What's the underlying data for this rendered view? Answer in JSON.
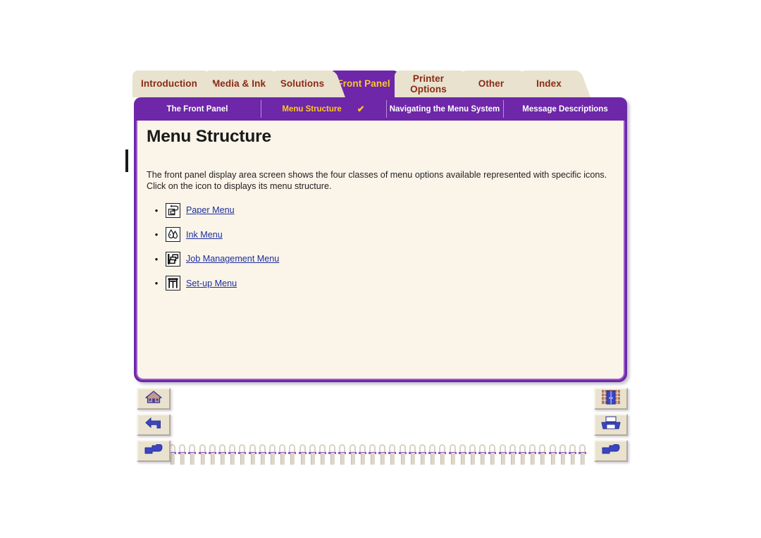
{
  "colors": {
    "purple": "#6d27a8",
    "tab_beige": "#e8e2cf",
    "tab_text": "#8c2a12",
    "active_tab_text": "#ffc71f",
    "page_cream": "#fbf4e9",
    "link_blue": "#1d2f9c",
    "panel_border": "#9b5fc9"
  },
  "tabs": [
    {
      "label": "Introduction",
      "active": false,
      "two_line": false
    },
    {
      "label": "Media & Ink",
      "active": false,
      "two_line": false
    },
    {
      "label": "Solutions",
      "active": false,
      "two_line": false
    },
    {
      "label": "Front Panel",
      "active": true,
      "two_line": false
    },
    {
      "label": "Printer\nOptions",
      "active": false,
      "two_line": true
    },
    {
      "label": "Other",
      "active": false,
      "two_line": false
    },
    {
      "label": "Index",
      "active": false,
      "two_line": false
    }
  ],
  "subtabs": [
    {
      "label": "The Front Panel",
      "selected": false,
      "check": false
    },
    {
      "label": "Menu Structure",
      "selected": true,
      "check": true
    },
    {
      "label": "Navigating the Menu System",
      "selected": false,
      "check": false
    },
    {
      "label": "Message Descriptions",
      "selected": false,
      "check": false
    }
  ],
  "checkmark_glyph": "✔",
  "bullet_glyph": "•",
  "page": {
    "title": "Menu Structure",
    "intro": "The front panel display area screen shows the four classes of menu options available represented with specific icons. Click on the icon to displays its menu structure.",
    "menu_items": [
      {
        "label": "Paper Menu",
        "icon": "paper-menu-icon"
      },
      {
        "label": "Ink Menu",
        "icon": "ink-menu-icon"
      },
      {
        "label": "Job Management Menu",
        "icon": "job-management-menu-icon"
      },
      {
        "label": "Set-up Menu",
        "icon": "set-up-menu-icon"
      }
    ]
  },
  "nav_buttons": {
    "home": {
      "icon": "home-icon"
    },
    "back": {
      "icon": "back-arrow-icon"
    },
    "next_left": {
      "icon": "pointing-hand-icon"
    },
    "exit": {
      "icon": "exit-door-icon"
    },
    "print": {
      "icon": "printer-icon"
    },
    "next_right": {
      "icon": "pointing-hand-icon"
    }
  },
  "spiral_ring_count": 42
}
